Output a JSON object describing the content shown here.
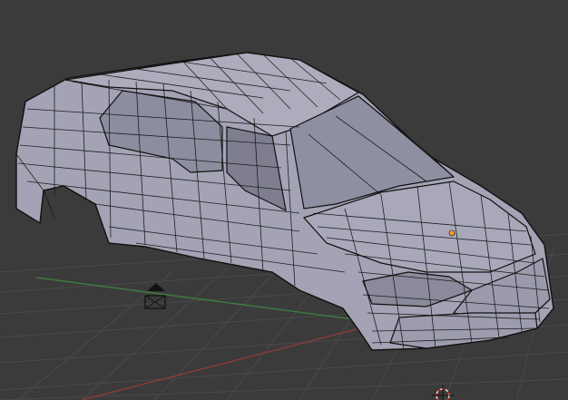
{
  "viewport": {
    "background": "#3b3b3b",
    "grid_color": "#4a4a4a",
    "x_axis_color": "#8a3a3a",
    "y_axis_color": "#3f7a3f",
    "mesh_fill": "#a3a3b5",
    "mesh_shade": "#8d8da0",
    "mesh_wire": "#111111",
    "selected_vertex_color": "#ff9a2e"
  },
  "objects": {
    "camera": {
      "icon": "camera-icon"
    },
    "lamp": {
      "icon": "lamp-icon"
    },
    "cursor": {
      "icon": "3d-cursor-icon"
    },
    "mesh": {
      "icon": "car-body-mesh"
    }
  }
}
